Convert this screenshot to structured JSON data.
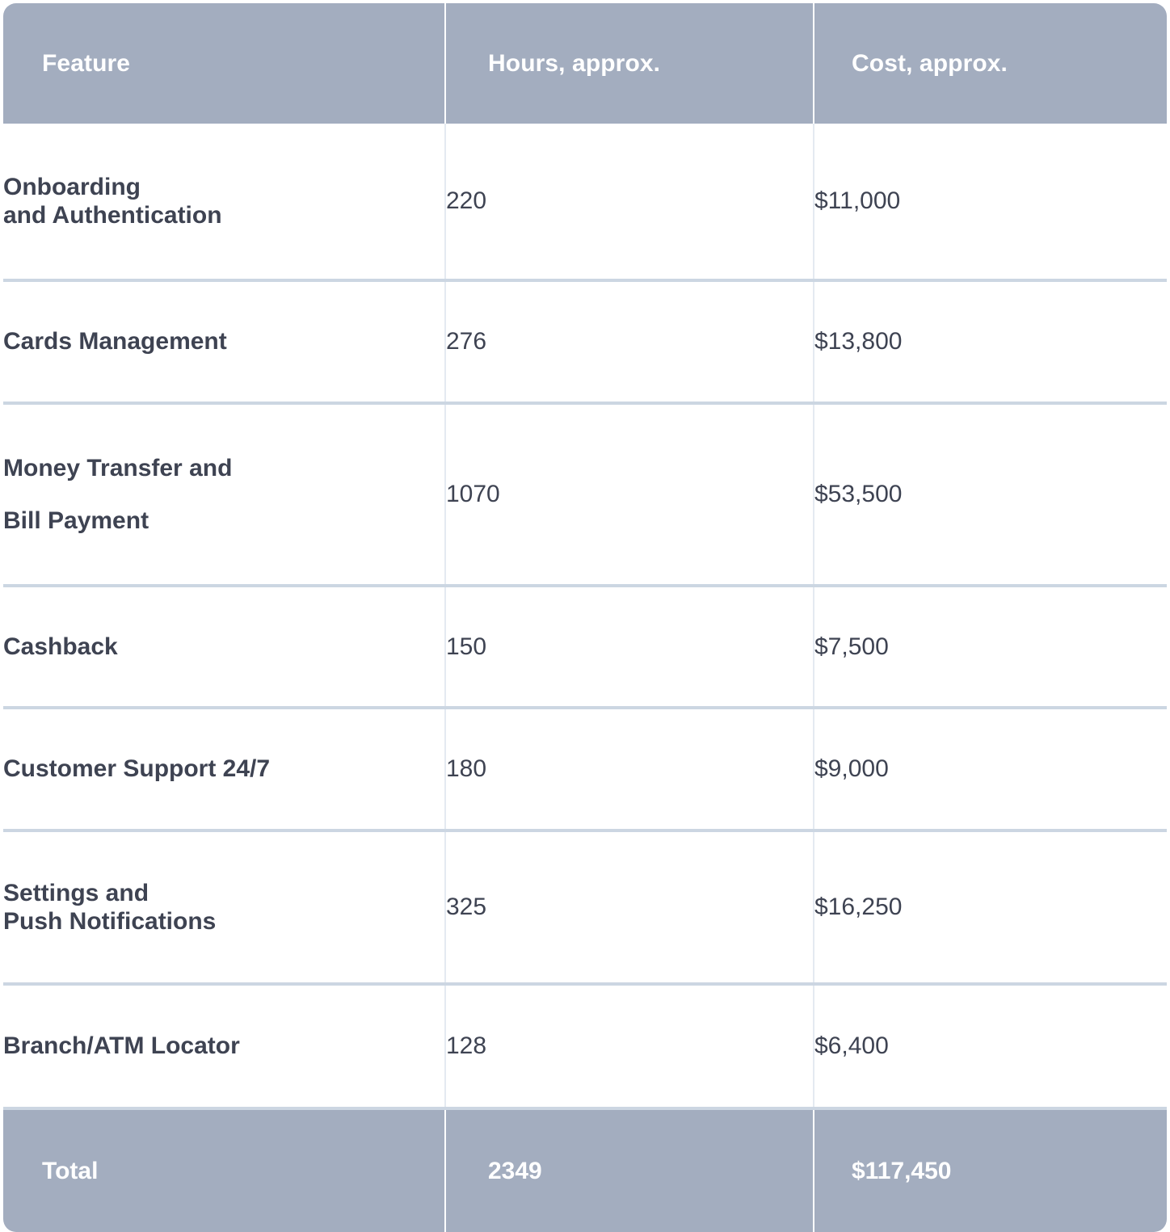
{
  "table": {
    "columns": [
      {
        "key": "feature",
        "label": "Feature"
      },
      {
        "key": "hours",
        "label": "Hours, approx."
      },
      {
        "key": "cost",
        "label": "Cost, approx."
      }
    ],
    "rows": [
      {
        "feature_line1": "Onboarding",
        "feature_line2": "and Authentication",
        "hours": "220",
        "cost": "$11,000"
      },
      {
        "feature_line1": "Cards Management",
        "feature_line2": "",
        "hours": "276",
        "cost": "$13,800"
      },
      {
        "feature_line1": "Money Transfer and",
        "feature_line2": "Bill Payment",
        "hours": "1070",
        "cost": "$53,500"
      },
      {
        "feature_line1": "Cashback",
        "feature_line2": "",
        "hours": "150",
        "cost": "$7,500"
      },
      {
        "feature_line1": " Customer Support 24/7",
        "feature_line2": "",
        "hours": "180",
        "cost": "$9,000"
      },
      {
        "feature_line1": "Settings and",
        "feature_line2": "Push Notifications",
        "hours": "325",
        "cost": "$16,250"
      },
      {
        "feature_line1": "Branch/ATM Locator",
        "feature_line2": "",
        "hours": "128",
        "cost": "$6,400"
      }
    ],
    "total": {
      "label": "Total",
      "hours": "2349",
      "cost": "$117,450"
    }
  },
  "colors": {
    "header_background": "#a3adbf",
    "header_text": "#ffffff",
    "body_background": "#ffffff",
    "body_text": "#3e4352",
    "row_divider": "#ccd6e2",
    "column_divider": "#e4eaf1"
  }
}
